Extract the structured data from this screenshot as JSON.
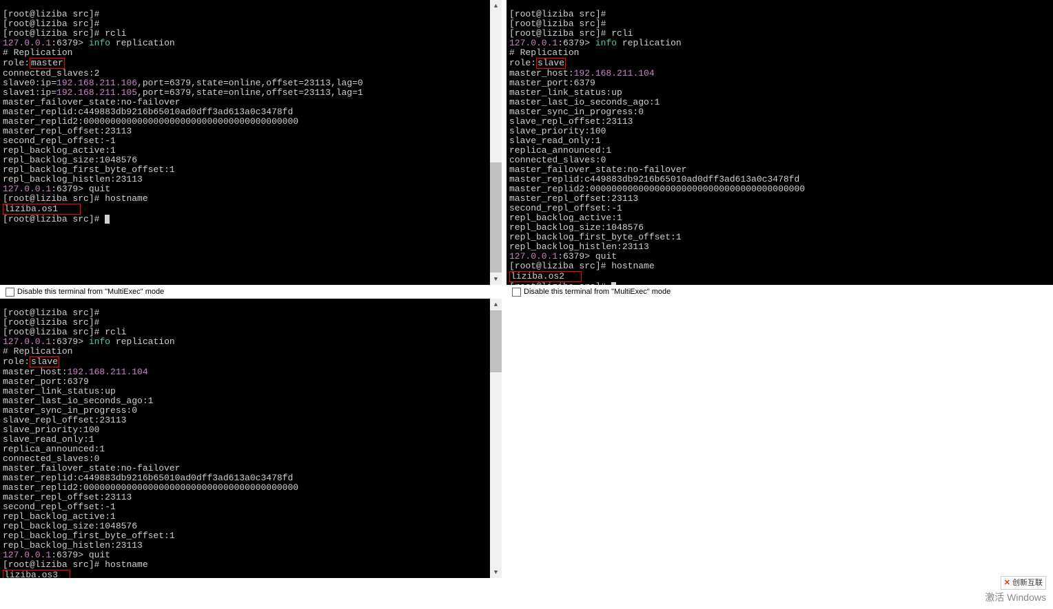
{
  "colors": {
    "ip_color": "#c586c0",
    "cmd_color": "#4ec9b0",
    "red_highlight": "#ff0000"
  },
  "disable_label": "Disable this terminal from \"MultiExec\" mode",
  "activate_windows": "激活 Windows",
  "logo_text": "创新互联",
  "pane1": {
    "prompt": "[root@liziba src]#",
    "rcli_cmd": "rcli",
    "redis_ip": "127.0.0.1",
    "redis_port": ":6379>",
    "info_cmd": "info",
    "info_arg": "replication",
    "section": "# Replication",
    "role_label": "role:",
    "role_value": "master",
    "lines": [
      "connected_slaves:2",
      "slave0:ip=",
      "192.168.211.106",
      ",port=6379,state=online,offset=23113,lag=0",
      "slave1:ip=",
      "192.168.211.105",
      ",port=6379,state=online,offset=23113,lag=1",
      "master_failover_state:no-failover",
      "master_replid:c449883db9216b65010ad0dff3ad613a0c3478fd",
      "master_replid2:0000000000000000000000000000000000000000",
      "master_repl_offset:23113",
      "second_repl_offset:-1",
      "repl_backlog_active:1",
      "repl_backlog_size:1048576",
      "repl_backlog_first_byte_offset:1",
      "repl_backlog_histlen:23113"
    ],
    "quit_cmd": "quit",
    "hostname_cmd": "hostname",
    "hostname": "liziba.os1"
  },
  "pane2": {
    "prompt": "[root@liziba src]#",
    "rcli_cmd": "rcli",
    "redis_ip": "127.0.0.1",
    "redis_port": ":6379>",
    "info_cmd": "info",
    "info_arg": "replication",
    "section": "# Replication",
    "role_label": "role:",
    "role_value": "slave",
    "master_host_label": "master_host:",
    "master_host_ip": "192.168.211.104",
    "lines": [
      "master_port:6379",
      "master_link_status:up",
      "master_last_io_seconds_ago:1",
      "master_sync_in_progress:0",
      "slave_repl_offset:23113",
      "slave_priority:100",
      "slave_read_only:1",
      "replica_announced:1",
      "connected_slaves:0",
      "master_failover_state:no-failover",
      "master_replid:c449883db9216b65010ad0dff3ad613a0c3478fd",
      "master_replid2:0000000000000000000000000000000000000000",
      "master_repl_offset:23113",
      "second_repl_offset:-1",
      "repl_backlog_active:1",
      "repl_backlog_size:1048576",
      "repl_backlog_first_byte_offset:1",
      "repl_backlog_histlen:23113"
    ],
    "quit_cmd": "quit",
    "hostname_cmd": "hostname",
    "hostname": "liziba.os2"
  },
  "pane3": {
    "prompt": "[root@liziba src]#",
    "rcli_cmd": "rcli",
    "redis_ip": "127.0.0.1",
    "redis_port": ":6379>",
    "info_cmd": "info",
    "info_arg": "replication",
    "section": "# Replication",
    "role_label": "role:",
    "role_value": "slave",
    "master_host_label": "master_host:",
    "master_host_ip": "192.168.211.104",
    "lines": [
      "master_port:6379",
      "master_link_status:up",
      "master_last_io_seconds_ago:1",
      "master_sync_in_progress:0",
      "slave_repl_offset:23113",
      "slave_priority:100",
      "slave_read_only:1",
      "replica_announced:1",
      "connected_slaves:0",
      "master_failover_state:no-failover",
      "master_replid:c449883db9216b65010ad0dff3ad613a0c3478fd",
      "master_replid2:0000000000000000000000000000000000000000",
      "master_repl_offset:23113",
      "second_repl_offset:-1",
      "repl_backlog_active:1",
      "repl_backlog_size:1048576",
      "repl_backlog_first_byte_offset:1",
      "repl_backlog_histlen:23113"
    ],
    "quit_cmd": "quit",
    "hostname_cmd": "hostname",
    "hostname": "liziba.os3"
  }
}
